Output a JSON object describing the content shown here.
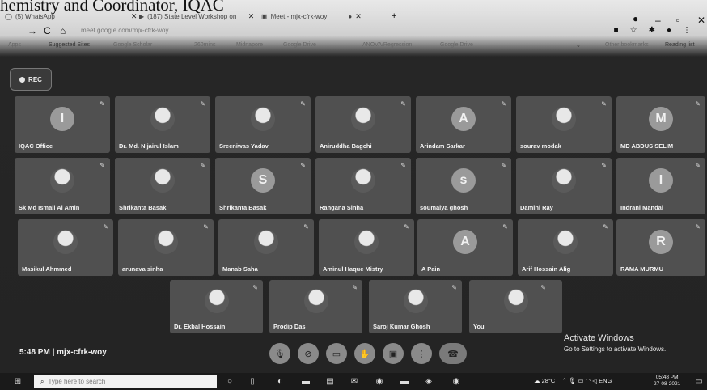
{
  "caption": "hemistry and Coordinator, IQAC",
  "browser": {
    "tabs": [
      {
        "label": "(5) WhatsApp"
      },
      {
        "label": "(187) State Level Workshop on I"
      },
      {
        "label": "Meet - mjx-cfrk-woy"
      }
    ],
    "new_tab": "+",
    "url": "meet.google.com/mjx-cfrk-woy",
    "bookmarks": [
      "Apps",
      "Suggested Sites",
      "Google Scholar",
      "260mins",
      "Midnapore",
      "Google Drive",
      "ANOVA/Regression",
      "Google Drive"
    ],
    "other_bookmarks": "Other bookmarks",
    "reading_list": "Reading list"
  },
  "meet": {
    "rec_label": "REC",
    "participants": [
      {
        "name": "IQAC Office",
        "initial": "I"
      },
      {
        "name": "Dr. Md. Nijairul Islam",
        "initial": ""
      },
      {
        "name": "Sreeniwas Yadav",
        "initial": ""
      },
      {
        "name": "Aniruddha Bagchi",
        "initial": ""
      },
      {
        "name": "Arindam Sarkar",
        "initial": "A"
      },
      {
        "name": "sourav modak",
        "initial": ""
      },
      {
        "name": "MD ABDUS SELIM",
        "initial": "M"
      },
      {
        "name": "Sk Md Ismail Al Amin",
        "initial": ""
      },
      {
        "name": "Shrikanta Basak",
        "initial": ""
      },
      {
        "name": "Shrikanta Basak",
        "initial": "S"
      },
      {
        "name": "Rangana Sinha",
        "initial": ""
      },
      {
        "name": "soumalya ghosh",
        "initial": "s"
      },
      {
        "name": "Damini Ray",
        "initial": ""
      },
      {
        "name": "Indrani Mandal",
        "initial": "I"
      },
      {
        "name": "Masikul Ahmmed",
        "initial": ""
      },
      {
        "name": "arunava sinha",
        "initial": ""
      },
      {
        "name": "Manab Saha",
        "initial": ""
      },
      {
        "name": "Aminul Haque Mistry",
        "initial": ""
      },
      {
        "name": "A Pain",
        "initial": "A"
      },
      {
        "name": "Arif Hossain Alig",
        "initial": ""
      },
      {
        "name": "RAMA MURMU",
        "initial": "R"
      },
      {
        "name": "Dr. Ekbal Hossain",
        "initial": ""
      },
      {
        "name": "Prodip Das",
        "initial": ""
      },
      {
        "name": "Saroj Kumar Ghosh",
        "initial": ""
      },
      {
        "name": "You",
        "initial": ""
      }
    ],
    "time_code": "5:48 PM  |  mjx-cfrk-woy"
  },
  "activate": {
    "line1": "Activate Windows",
    "line2": "Go to Settings to activate Windows."
  },
  "taskbar": {
    "search_placeholder": "Type here to search",
    "weather": "28°C",
    "lang": "ENG",
    "time": "05:48 PM",
    "date": "27-08-2021"
  }
}
